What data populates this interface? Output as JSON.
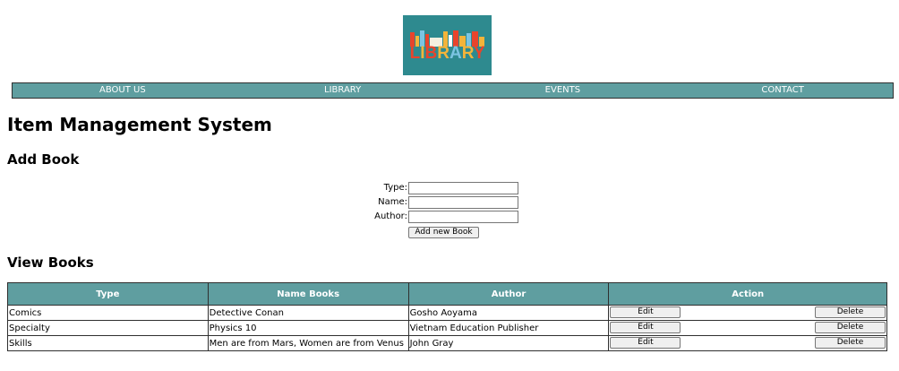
{
  "logo": {
    "text": "LIBRARY",
    "colors": [
      "#2e8a8f",
      "#e8442c",
      "#f3b43a",
      "#7cc4e2"
    ]
  },
  "nav": {
    "items": [
      "ABOUT US",
      "LIBRARY",
      "EVENTS",
      "CONTACT"
    ],
    "color": "#5f9ea0"
  },
  "page_title": "Item Management System",
  "add_book": {
    "heading": "Add Book",
    "type_label": "Type:",
    "name_label": "Name:",
    "author_label": "Author:",
    "type_value": "",
    "name_value": "",
    "author_value": "",
    "button_label": "Add new Book"
  },
  "view_books": {
    "heading": "View Books",
    "columns": [
      "Type",
      "Name Books",
      "Author",
      "Action"
    ],
    "rows": [
      {
        "type": "Comics",
        "name": "Detective Conan",
        "author": "Gosho Aoyama",
        "edit": "Edit",
        "delete": "Delete"
      },
      {
        "type": "Specialty",
        "name": "Physics 10",
        "author": "Vietnam Education Publisher",
        "edit": "Edit",
        "delete": "Delete"
      },
      {
        "type": "Skills",
        "name": "Men are from Mars, Women are from Venus",
        "author": "John Gray",
        "edit": "Edit",
        "delete": "Delete"
      }
    ]
  }
}
